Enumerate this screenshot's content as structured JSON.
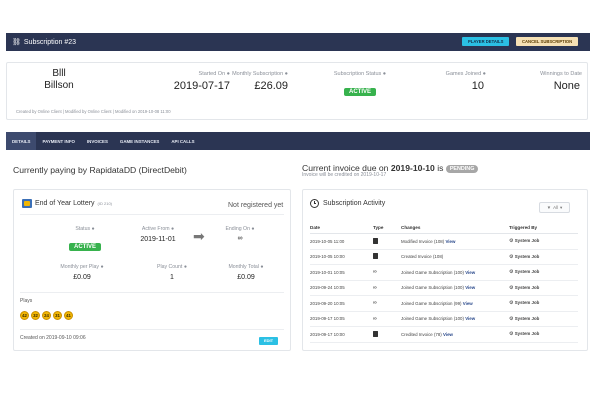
{
  "header": {
    "icon": "link-icon",
    "title": "Subscription #23",
    "player_details_label": "PLAYER DETAILS",
    "cancel_label": "CANCEL SUBSCRIPTION"
  },
  "summary": {
    "first_name": "Blll",
    "last_name": "Billson",
    "started_on_label": "Started On",
    "started_on": "2019-07-17",
    "monthly_label": "Monthly Subscription",
    "monthly": "£26.09",
    "status_label": "Subscription Status",
    "status": "ACTIVE",
    "games_label": "Games Joined",
    "games": "10",
    "winnings_label": "Winnings to Date",
    "winnings": "None",
    "created_line": "Created by Online Client | Modified by Online Client | Modified on 2019-10-08 11:00"
  },
  "tabs": [
    "DETAILS",
    "PAYMENT INFO",
    "INVOICES",
    "GAME INSTANCES",
    "API CALLS"
  ],
  "paying": {
    "prefix": "Currently paying by",
    "method": "RapidataDD (DirectDebit)"
  },
  "invoice": {
    "prefix": "Current invoice due on",
    "date": "2019-10-10",
    "is_word": "is",
    "status": "PENDING",
    "credited": "Invoice will be credited on 2019-10-17"
  },
  "lottery": {
    "title": "End of Year Lottery",
    "id": "(ID 210)",
    "registration": "Not registered yet",
    "status_label": "Status",
    "status": "ACTIVE",
    "active_from_label": "Active From",
    "active_from": "2019-11-01",
    "ending_on_label": "Ending On",
    "ending_on": "∞",
    "monthly_play_label": "Monthly per Play",
    "monthly_play": "£0.09",
    "play_count_label": "Play Count",
    "play_count": "1",
    "monthly_total_label": "Monthly Total",
    "monthly_total": "£0.09",
    "plays_label": "Plays",
    "balls": [
      "42",
      "32",
      "24",
      "31",
      "41"
    ],
    "created": "Created on 2019-09-10 09:06",
    "edit_label": "EDIT"
  },
  "activity": {
    "title": "Subscription Activity",
    "filter_label": "All",
    "headers": [
      "Date",
      "Type",
      "Changes",
      "Triggered By"
    ],
    "rows": [
      {
        "date": "2019-10-05 11:00",
        "type": "document-icon",
        "change": "Modified Invoice (108)",
        "view": "View",
        "by": "System Job"
      },
      {
        "date": "2019-10-05 10:00",
        "type": "document-icon",
        "change": "Created Invoice (108)",
        "view": "",
        "by": "System Job"
      },
      {
        "date": "2019-10-01 10:05",
        "type": "mask-icon",
        "change": "Joined Game Subscription (100)",
        "view": "View",
        "by": "System Job"
      },
      {
        "date": "2019-09-24 10:05",
        "type": "mask-icon",
        "change": "Joined Game Subscription (100)",
        "view": "View",
        "by": "System Job"
      },
      {
        "date": "2019-09-20 10:05",
        "type": "mask-icon",
        "change": "Joined Game Subscription (99)",
        "view": "View",
        "by": "System Job"
      },
      {
        "date": "2019-09-17 10:05",
        "type": "mask-icon",
        "change": "Joined Game Subscription (100)",
        "view": "View",
        "by": "System Job"
      },
      {
        "date": "2019-09-17 10:00",
        "type": "document-icon",
        "change": "Credited Invoice (78)",
        "view": "View",
        "by": "System Job"
      }
    ]
  }
}
